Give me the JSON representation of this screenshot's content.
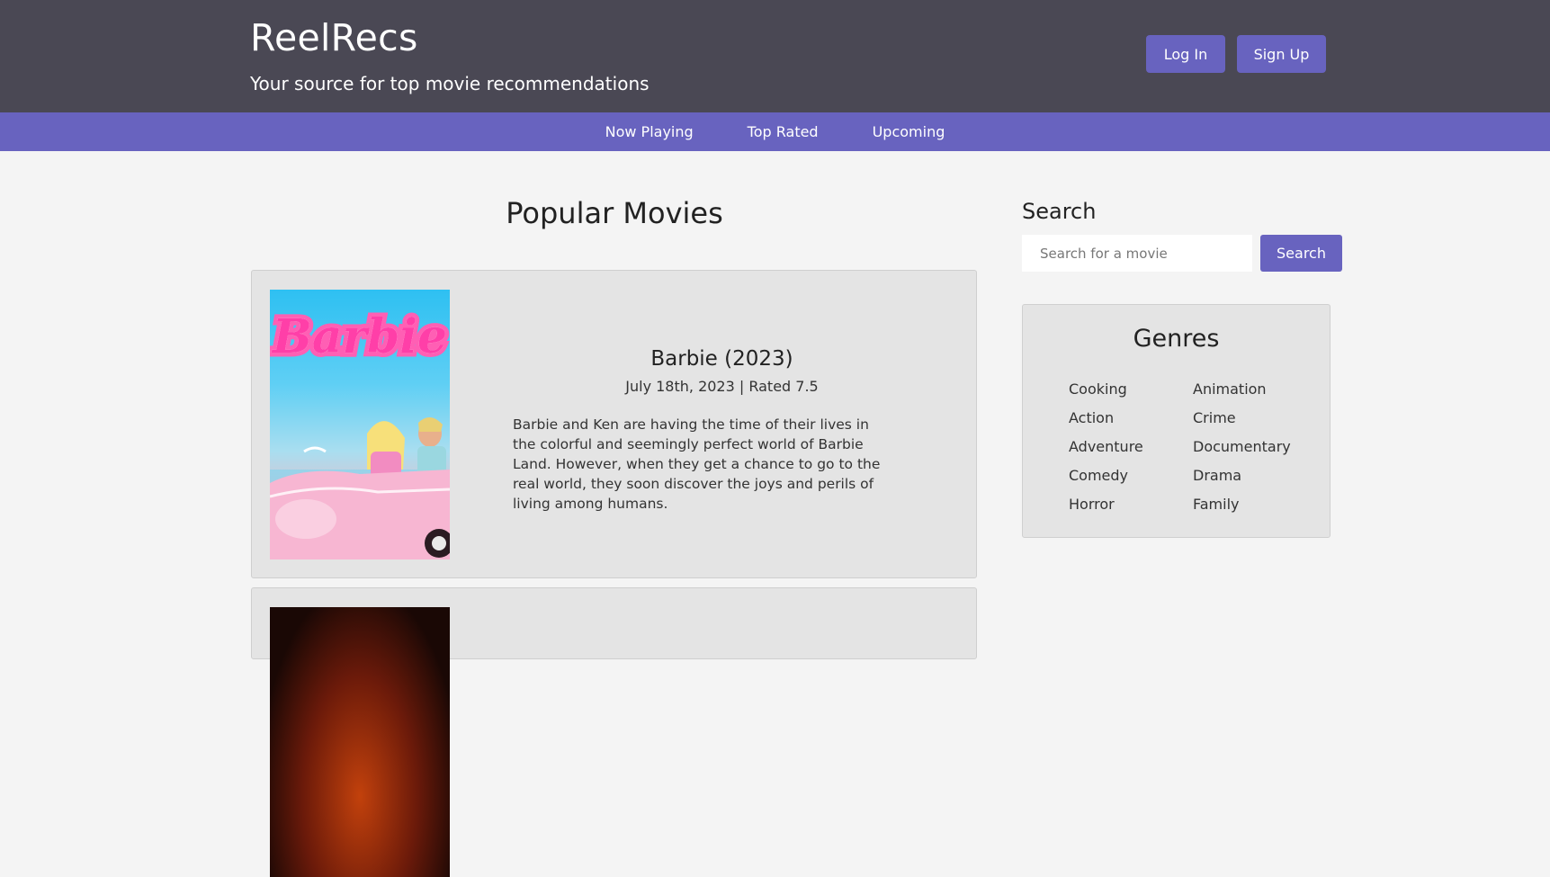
{
  "header": {
    "title": "ReelRecs",
    "tagline": "Your source for top movie recommendations",
    "login_label": "Log In",
    "signup_label": "Sign Up"
  },
  "nav": {
    "items": [
      {
        "label": "Now Playing"
      },
      {
        "label": "Top Rated"
      },
      {
        "label": "Upcoming"
      }
    ]
  },
  "main": {
    "section_title": "Popular Movies",
    "movies": [
      {
        "title": "Barbie (2023)",
        "meta": "July 18th, 2023 | Rated 7.5",
        "overview": "Barbie and Ken are having the time of their lives in the colorful and seemingly perfect world of Barbie Land. However, when they get a chance to go to the real world, they soon discover the joys and perils of living among humans.",
        "poster_logo": "Barbie"
      }
    ]
  },
  "sidebar": {
    "search_heading": "Search",
    "search_placeholder": "Search for a movie",
    "search_button": "Search",
    "genres_title": "Genres",
    "genres": [
      "Cooking",
      "Animation",
      "Action",
      "Crime",
      "Adventure",
      "Documentary",
      "Comedy",
      "Drama",
      "Horror",
      "Family"
    ]
  },
  "colors": {
    "header_bg": "#4a4854",
    "accent": "#6863bf",
    "card_bg": "#e4e4e4",
    "page_bg": "#f4f4f4"
  }
}
